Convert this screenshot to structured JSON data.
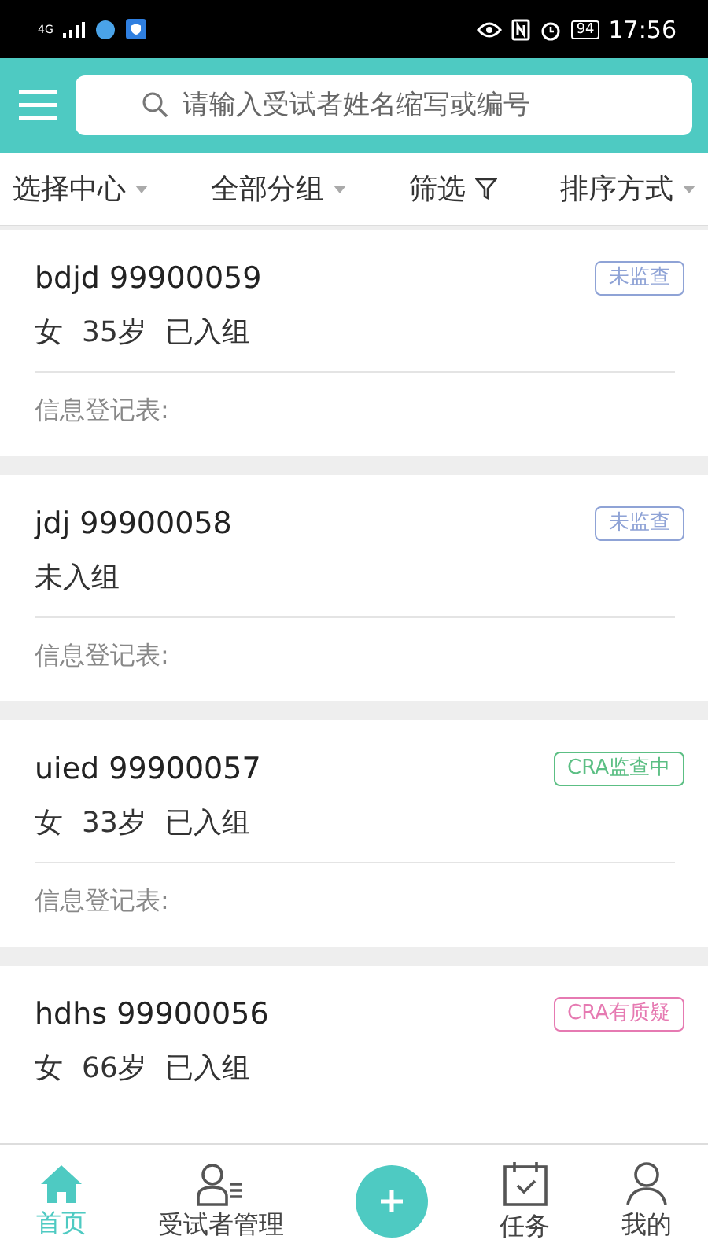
{
  "status_bar": {
    "network": "4G",
    "battery": "94",
    "time": "17:56"
  },
  "search": {
    "placeholder": "请输入受试者姓名缩写或编号"
  },
  "filters": [
    {
      "label": "选择中心",
      "kind": "dropdown"
    },
    {
      "label": "全部分组",
      "kind": "dropdown"
    },
    {
      "label": "筛选",
      "kind": "filter"
    },
    {
      "label": "排序方式",
      "kind": "dropdown"
    }
  ],
  "subjects": [
    {
      "name": "bdjd 99900059",
      "tag": "未监查",
      "color": "#8fa3d6",
      "info": [
        "女",
        "35岁",
        "已入组"
      ],
      "form_label": "信息登记表:"
    },
    {
      "name": "jdj 99900058",
      "tag": "未监查",
      "color": "#8fa3d6",
      "info": [
        "未入组"
      ],
      "form_label": "信息登记表:"
    },
    {
      "name": "uied 99900057",
      "tag": "CRA监查中",
      "color": "#5cbf84",
      "info": [
        "女",
        "33岁",
        "已入组"
      ],
      "form_label": "信息登记表:"
    },
    {
      "name": "hdhs 99900056",
      "tag": "CRA有质疑",
      "color": "#e67ab2",
      "info": [
        "女",
        "66岁",
        "已入组"
      ]
    }
  ],
  "nav": [
    {
      "label": "首页",
      "kind": "tab",
      "selected": true
    },
    {
      "label": "受试者管理",
      "kind": "tab",
      "selected": false
    },
    {
      "kind": "add"
    },
    {
      "label": "任务",
      "kind": "tab",
      "selected": false
    },
    {
      "label": "我的",
      "kind": "tab",
      "selected": false
    }
  ]
}
